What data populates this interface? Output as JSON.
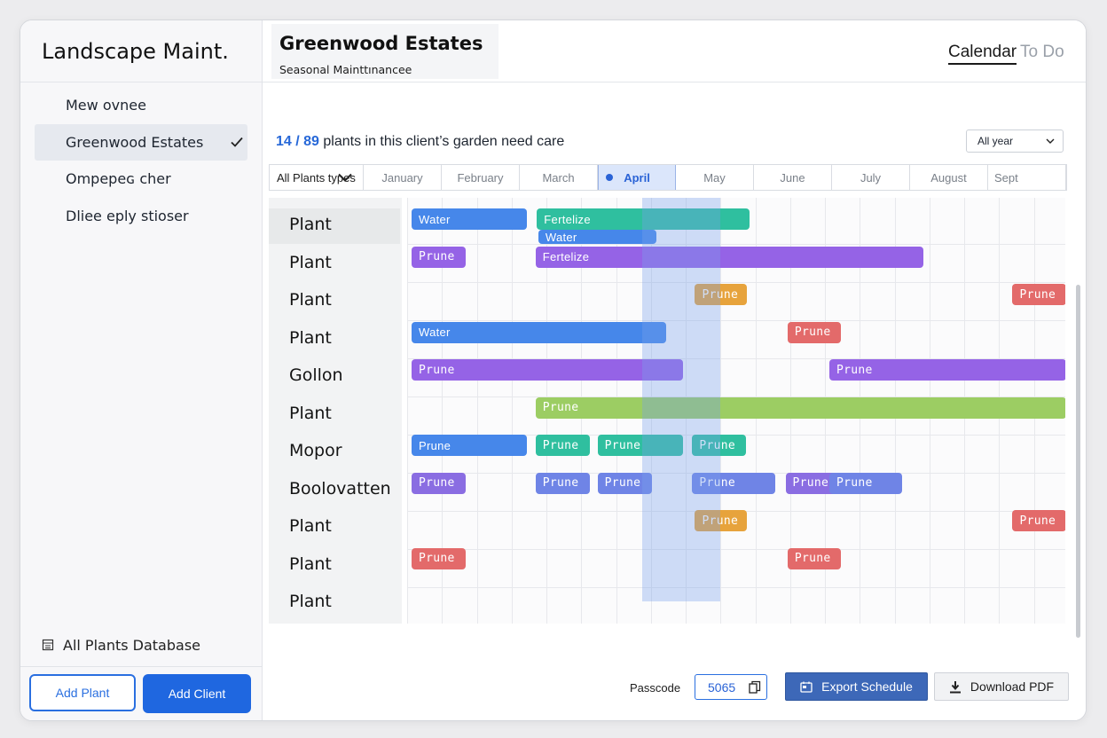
{
  "sidebar": {
    "app_title": "Landscape Maint.",
    "clients": [
      {
        "label": "Mew ovnee",
        "active": false
      },
      {
        "label": "Greenwood Estates",
        "active": true
      },
      {
        "label": "Ompepeɢ cher",
        "active": false
      },
      {
        "label": "Dliee eply stioser",
        "active": false
      }
    ],
    "database_link": "All Plants Database",
    "add_plant": "Add Plant",
    "add_client": "Add Client"
  },
  "header": {
    "title": "Greenwood Estates",
    "subtitle": "Seasonal Mainttınancee",
    "tabs": [
      "Calendar",
      "To Do"
    ],
    "active_tab": "Calendar"
  },
  "summary": {
    "count": "14 / 89",
    "text": "plants in this client’s garden need care"
  },
  "year_filter": {
    "selected": "All year"
  },
  "type_filter": {
    "selected": "All Plants types"
  },
  "months": [
    "January",
    "February",
    "March",
    "April",
    "May",
    "June",
    "July",
    "August",
    "Sept"
  ],
  "current_month": "April",
  "plants": [
    "Plant",
    "Plant",
    "Plant",
    "Plant",
    "Gollon",
    "Plant",
    "Mopor",
    "Boolovatten",
    "Plant",
    "Plant",
    "Plant"
  ],
  "tasks": [
    {
      "row": 0,
      "label": "Water",
      "color": "blue",
      "start_month": 1.0,
      "end_month": 2.65
    },
    {
      "row": 0,
      "label": "Fertelize",
      "color": "teal",
      "start_month": 2.8,
      "end_month": 5.85
    },
    {
      "row": 0,
      "label": "Water",
      "color": "blue",
      "start_month": 2.82,
      "end_month": 4.52,
      "sub": true
    },
    {
      "row": 1,
      "label": "Prune",
      "color": "purple",
      "start_month": 1.0,
      "end_month": 1.78
    },
    {
      "row": 1,
      "label": "Fertelize",
      "color": "purple",
      "start_month": 2.78,
      "end_month": 8.35
    },
    {
      "row": 2,
      "label": "Prune",
      "color": "orange",
      "start_month": 5.07,
      "end_month": 5.82
    },
    {
      "row": 2,
      "label": "Prune",
      "color": "red",
      "start_month": 9.63,
      "end_month": 10.4
    },
    {
      "row": 3,
      "label": "Water",
      "color": "blue",
      "start_month": 1.0,
      "end_month": 4.65
    },
    {
      "row": 3,
      "label": "Prune",
      "color": "red",
      "start_month": 6.4,
      "end_month": 7.17
    },
    {
      "row": 4,
      "label": "Prune",
      "color": "purple",
      "start_month": 1.0,
      "end_month": 4.9
    },
    {
      "row": 4,
      "label": "Prune",
      "color": "purple",
      "start_month": 7.0,
      "end_month": 10.4
    },
    {
      "row": 5,
      "label": "Prune",
      "color": "green",
      "start_month": 2.78,
      "end_month": 10.4
    },
    {
      "row": 6,
      "label": "Prune",
      "color": "blue",
      "start_month": 1.0,
      "end_month": 2.65
    },
    {
      "row": 6,
      "label": "Prune",
      "color": "teal",
      "start_month": 2.78,
      "end_month": 3.56
    },
    {
      "row": 6,
      "label": "Prune",
      "color": "teal",
      "start_month": 3.67,
      "end_month": 4.9
    },
    {
      "row": 6,
      "label": "Prune",
      "color": "teal",
      "start_month": 5.03,
      "end_month": 5.8
    },
    {
      "row": 7,
      "label": "Prune",
      "color": "violet",
      "start_month": 1.0,
      "end_month": 1.78
    },
    {
      "row": 7,
      "label": "Prune",
      "color": "indigo",
      "start_month": 2.78,
      "end_month": 3.56
    },
    {
      "row": 7,
      "label": "Prune",
      "color": "indigo",
      "start_month": 3.67,
      "end_month": 4.45
    },
    {
      "row": 7,
      "label": "Prune",
      "color": "indigo",
      "start_month": 5.03,
      "end_month": 6.22
    },
    {
      "row": 7,
      "label": "Prune",
      "color": "violet",
      "start_month": 6.37,
      "end_month": 7.17
    },
    {
      "row": 7,
      "label": "Prune",
      "color": "indigo",
      "start_month": 7.0,
      "end_month": 8.05
    },
    {
      "row": 8,
      "label": "Prune",
      "color": "orange",
      "start_month": 5.07,
      "end_month": 5.82
    },
    {
      "row": 8,
      "label": "Prune",
      "color": "red",
      "start_month": 9.63,
      "end_month": 10.4
    },
    {
      "row": 9,
      "label": "Prune",
      "color": "red",
      "start_month": 1.0,
      "end_month": 1.78
    },
    {
      "row": 9,
      "label": "Prune",
      "color": "red",
      "start_month": 6.4,
      "end_month": 7.17
    }
  ],
  "footer": {
    "passcode_label": "Passcode",
    "passcode_value": "5065",
    "export_label": "Export Schedule",
    "download_label": "Download PDF"
  },
  "colors": {
    "accent": "#1f67e0",
    "blue": "#4687ea",
    "teal": "#2fbf9f",
    "purple": "#9563e6",
    "orange": "#e7a33c",
    "red": "#e36a6a",
    "green": "#9ccd63"
  }
}
